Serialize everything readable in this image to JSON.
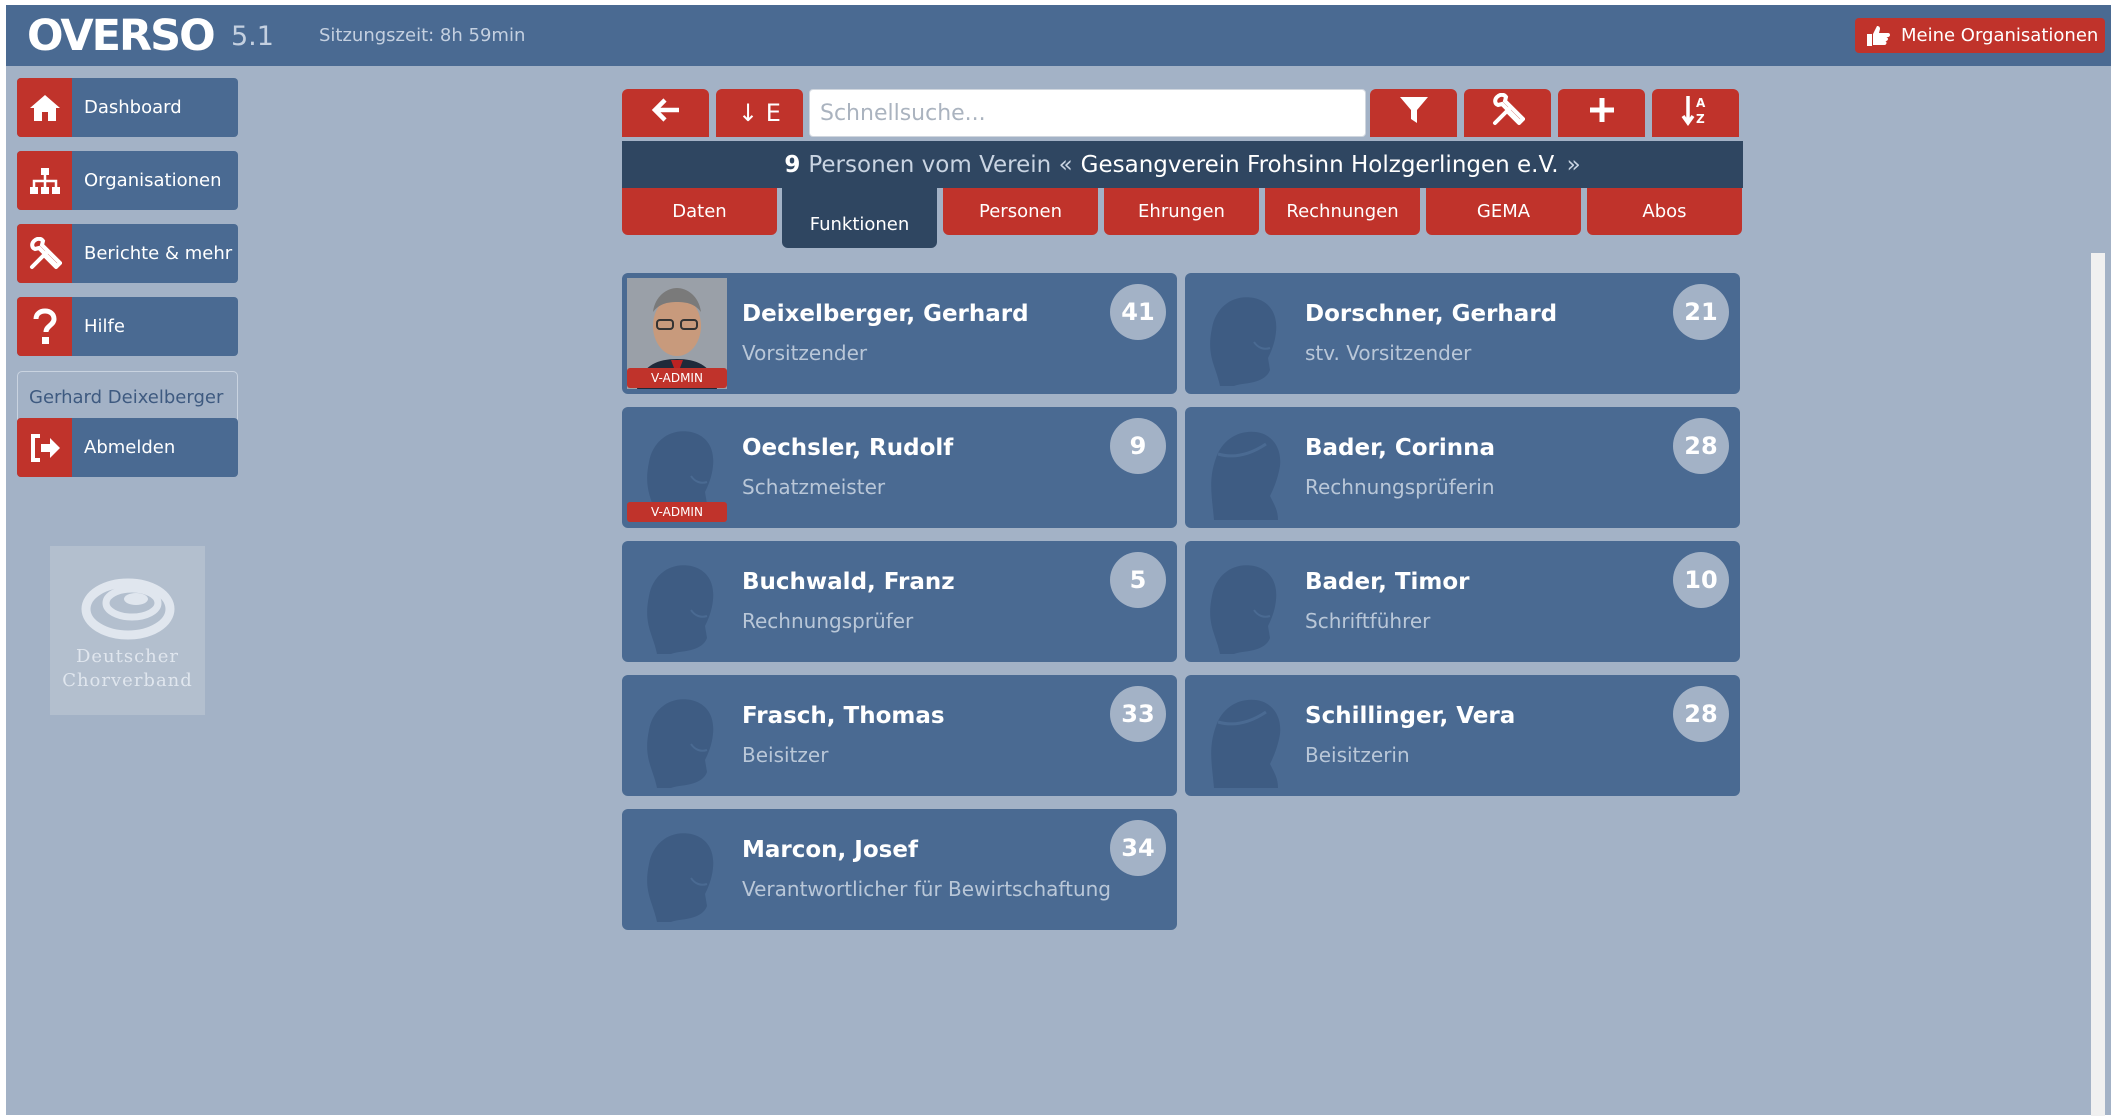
{
  "app": {
    "logo": "OVERSO",
    "version": "5.1",
    "session": "Sitzungszeit: 8h 59min",
    "my_orgs": "Meine Organisationen"
  },
  "sidebar": {
    "items": [
      {
        "label": "Dashboard",
        "icon": "home-icon"
      },
      {
        "label": "Organisationen",
        "icon": "sitemap-icon"
      },
      {
        "label": "Berichte & mehr",
        "icon": "tools-icon"
      },
      {
        "label": "Hilfe",
        "icon": "question-icon"
      }
    ],
    "user": "Gerhard Deixelberger",
    "logout": "Abmelden",
    "logo_line1": "Deutscher",
    "logo_line2": "Chorverband"
  },
  "toolbar": {
    "back": "←",
    "sort_e": "↓ E",
    "search_placeholder": "Schnellsuche...",
    "filter": "filter-icon",
    "tools": "tools-icon",
    "add": "+",
    "sort": "sort-az-icon"
  },
  "banner": {
    "count": "9",
    "text": "Personen vom Verein «",
    "club": "Gesangverein Frohsinn Holzgerlingen e.V.",
    "close": "»"
  },
  "tabs": [
    "Daten",
    "Funktionen",
    "Personen",
    "Ehrungen",
    "Rechnungen",
    "GEMA",
    "Abos"
  ],
  "active_tab": "Funktionen",
  "people": [
    {
      "name": "Deixelberger, Gerhard",
      "role": "Vorsitzender",
      "count": "41",
      "badge": "V-ADMIN",
      "avatar": "photo"
    },
    {
      "name": "Dorschner, Gerhard",
      "role": "stv. Vorsitzender",
      "count": "21",
      "badge": "",
      "avatar": "male"
    },
    {
      "name": "Oechsler, Rudolf",
      "role": "Schatzmeister",
      "count": "9",
      "badge": "V-ADMIN",
      "avatar": "male"
    },
    {
      "name": "Bader, Corinna",
      "role": "Rechnungsprüferin",
      "count": "28",
      "badge": "",
      "avatar": "female"
    },
    {
      "name": "Buchwald, Franz",
      "role": "Rechnungsprüfer",
      "count": "5",
      "badge": "",
      "avatar": "male"
    },
    {
      "name": "Bader, Timor",
      "role": "Schriftführer",
      "count": "10",
      "badge": "",
      "avatar": "male"
    },
    {
      "name": "Frasch, Thomas",
      "role": "Beisitzer",
      "count": "33",
      "badge": "",
      "avatar": "male"
    },
    {
      "name": "Schillinger, Vera",
      "role": "Beisitzerin",
      "count": "28",
      "badge": "",
      "avatar": "female"
    },
    {
      "name": "Marcon, Josef",
      "role": "Verantwortlicher für Bewirtschaftung",
      "count": "34",
      "badge": "",
      "avatar": "male"
    }
  ],
  "colors": {
    "brand_red": "#c0332b",
    "panel_blue": "#4a6a92",
    "dark_navy": "#2f4661",
    "background": "#a3b2c6"
  }
}
